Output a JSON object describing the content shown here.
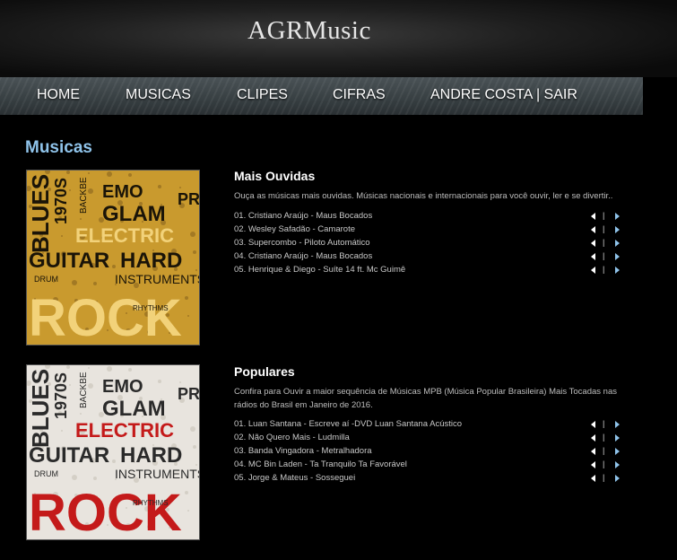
{
  "header": {
    "logo": "AGRMusic"
  },
  "nav": [
    {
      "label": "HOME"
    },
    {
      "label": "MUSICAS"
    },
    {
      "label": "CLIPES"
    },
    {
      "label": "CIFRAS"
    },
    {
      "label": "ANDRE COSTA | SAIR"
    }
  ],
  "page": {
    "title": "Musicas"
  },
  "sections": [
    {
      "title": "Mais Ouvidas",
      "description": "Ouça as músicas mais ouvidas. Músicas nacionais e internacionais para você ouvir, ler e se divertir..",
      "album_words": [
        "BLUES",
        "EMO",
        "GLAM",
        "ELECTRIC",
        "GUITAR",
        "HARD",
        "ROCK",
        "1970S",
        "BACKBE",
        "PRO",
        "INSTRUMENTS",
        "DRUM",
        "RHYTHMS"
      ],
      "tracks": [
        {
          "name": "01. Cristiano Araújo - Maus Bocados",
          "sep": "|"
        },
        {
          "name": "02. Wesley Safadão - Camarote",
          "sep": "|"
        },
        {
          "name": "03. Supercombo - Piloto Automático",
          "sep": "|"
        },
        {
          "name": "04. Cristiano Araújo - Maus Bocados",
          "sep": "|"
        },
        {
          "name": "05. Henrique & Diego - Suíte 14 ft. Mc Guimê",
          "sep": "|"
        }
      ]
    },
    {
      "title": "Populares",
      "description": "Confira para Ouvir a maior sequência de Músicas MPB (Música Popular Brasileira) Mais Tocadas nas rádios do Brasil em Janeiro de 2016.",
      "album_words": [
        "BLUES",
        "EMO",
        "GLAM",
        "ELECTRIC",
        "GUITAR",
        "HARD",
        "ROCK",
        "1970S",
        "BACKBE",
        "PRO",
        "INSTRUMENTS",
        "DRUM",
        "RHYTHMS"
      ],
      "tracks": [
        {
          "name": "01. Luan Santana - Escreve aí -DVD Luan Santana Acústico",
          "sep": "|"
        },
        {
          "name": "02. Não Quero Mais - Ludmilla",
          "sep": "|"
        },
        {
          "name": "03. Banda Vingadora - Metralhadora",
          "sep": "|"
        },
        {
          "name": "04. MC Bin Laden - Ta Tranquilo Ta Favorável",
          "sep": "|"
        },
        {
          "name": "05. Jorge & Mateus - Sosseguei",
          "sep": "|"
        }
      ]
    }
  ],
  "colors": {
    "accent": "#8fc3ea",
    "album1_bg": "#c99a2e",
    "album1_text": "#1a1408",
    "album1_light": "#f2d27a",
    "album2_bg": "#e8e4de",
    "album2_text": "#2a2a2a",
    "album2_red": "#c41a1a"
  }
}
